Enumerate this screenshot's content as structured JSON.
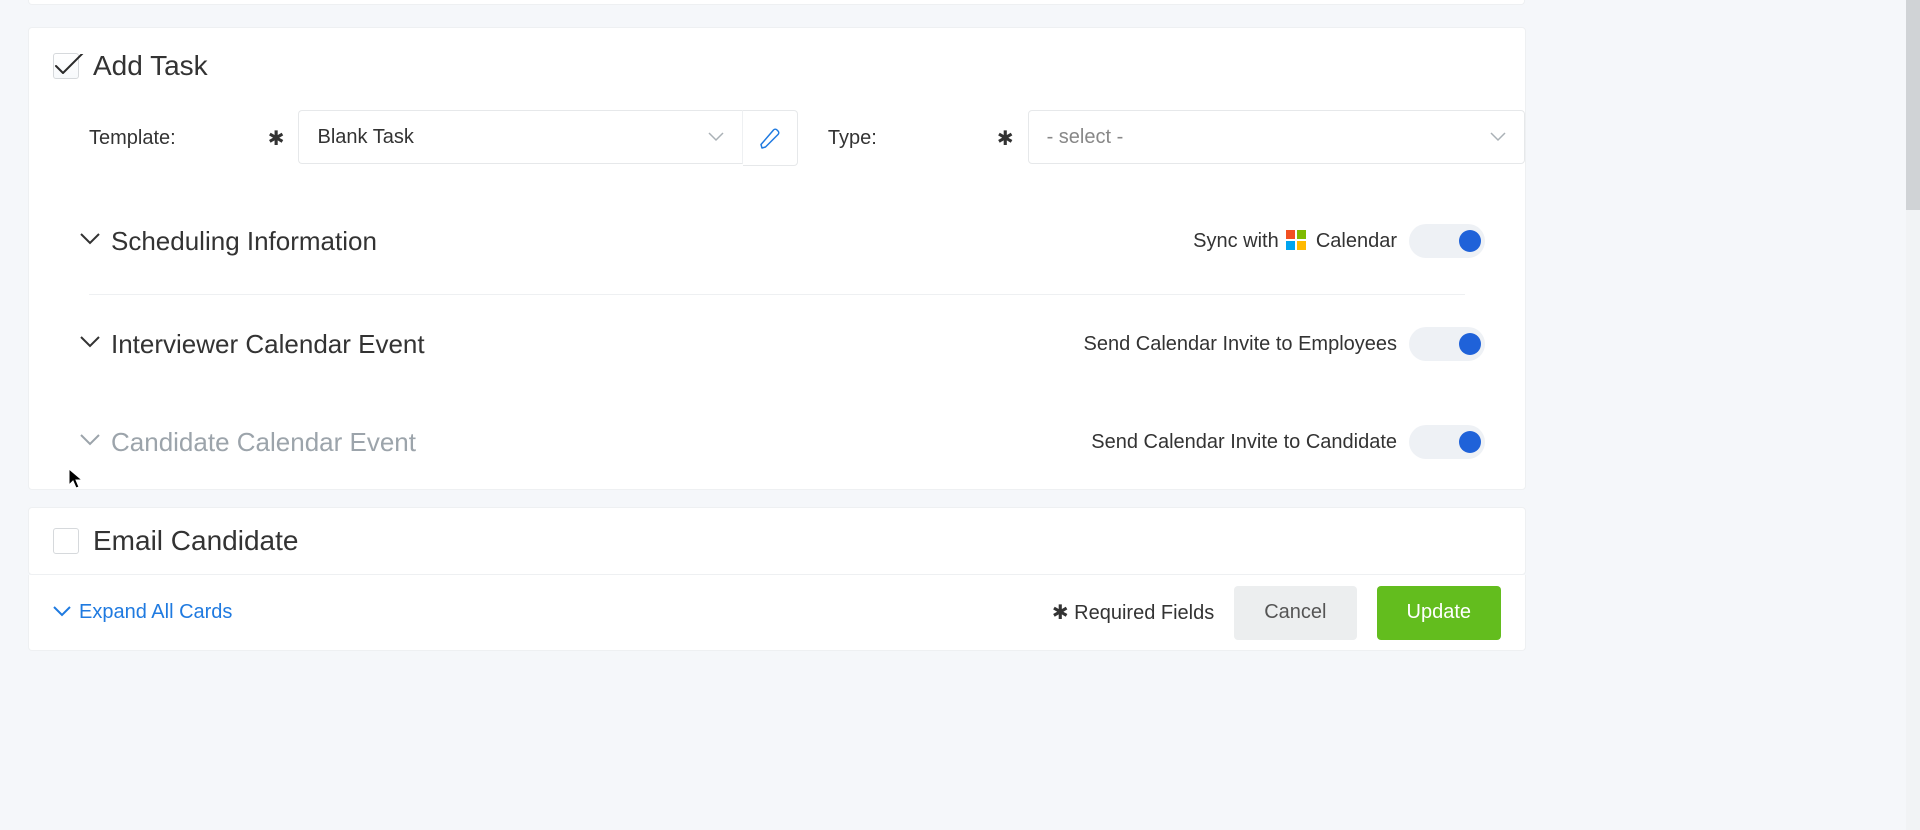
{
  "addTask": {
    "title": "Add Task",
    "checked": true,
    "template": {
      "label": "Template:",
      "value": "Blank Task"
    },
    "type": {
      "label": "Type:",
      "value": "- select -"
    },
    "sections": [
      {
        "title": "Scheduling Information",
        "muted": false,
        "toggleLabel": "Sync with",
        "toggleBrand": "Calendar",
        "toggleOn": true
      },
      {
        "title": "Interviewer Calendar Event",
        "muted": false,
        "toggleLabel": "Send Calendar Invite to Employees",
        "toggleOn": true
      },
      {
        "title": "Candidate Calendar Event",
        "muted": true,
        "toggleLabel": "Send Calendar Invite to Candidate",
        "toggleOn": true
      }
    ]
  },
  "emailCandidate": {
    "title": "Email Candidate",
    "checked": false
  },
  "footer": {
    "expand": "Expand All Cards",
    "requiredNote": "Required Fields",
    "cancel": "Cancel",
    "update": "Update"
  }
}
